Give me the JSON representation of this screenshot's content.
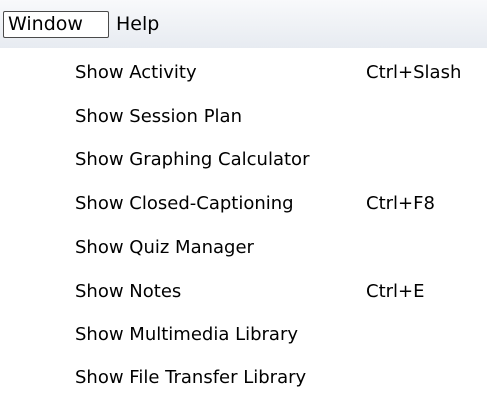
{
  "menubar": {
    "items": [
      {
        "label": "Window",
        "active": true
      },
      {
        "label": "Help",
        "active": false
      }
    ]
  },
  "window_menu": {
    "items": [
      {
        "label": "Show Activity",
        "shortcut": "Ctrl+Slash"
      },
      {
        "label": "Show Session Plan",
        "shortcut": ""
      },
      {
        "label": "Show Graphing Calculator",
        "shortcut": ""
      },
      {
        "label": "Show Closed-Captioning",
        "shortcut": "Ctrl+F8"
      },
      {
        "label": "Show Quiz Manager",
        "shortcut": ""
      },
      {
        "label": "Show Notes",
        "shortcut": "Ctrl+E"
      },
      {
        "label": "Show Multimedia Library",
        "shortcut": ""
      },
      {
        "label": "Show File Transfer Library",
        "shortcut": ""
      }
    ]
  }
}
